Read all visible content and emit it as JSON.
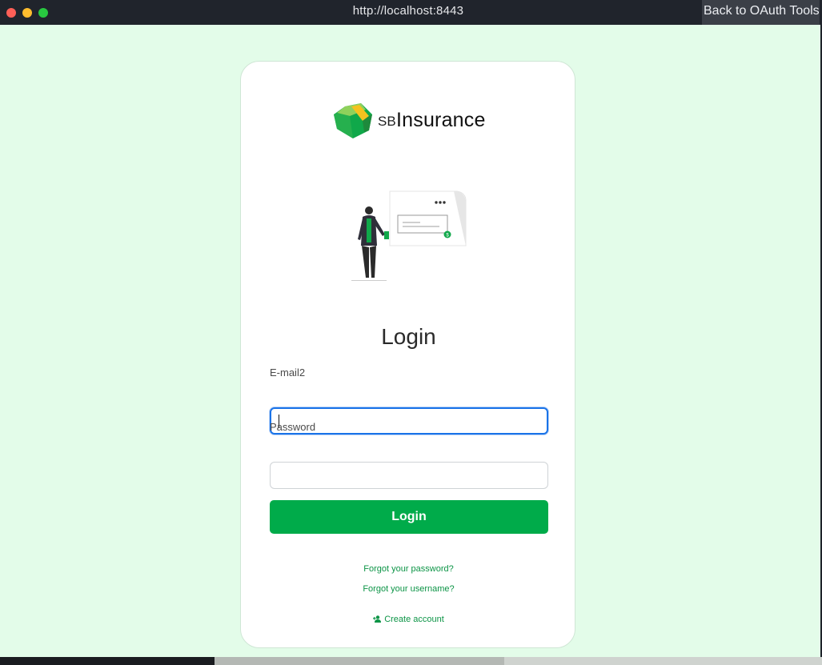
{
  "window": {
    "url": "http://localhost:8443",
    "back_button": "Back to OAuth Tools"
  },
  "brand": {
    "prefix": "SB",
    "name": "Insurance",
    "accent_color": "#00ab4a"
  },
  "login": {
    "heading": "Login",
    "email_label": "E-mail2",
    "email_value": "",
    "password_label": "Password",
    "password_value": "",
    "submit_label": "Login",
    "forgot_password": "Forgot your password?",
    "forgot_username": "Forgot your username?",
    "create_account": "Create account",
    "create_account_icon": "add-user-icon"
  }
}
